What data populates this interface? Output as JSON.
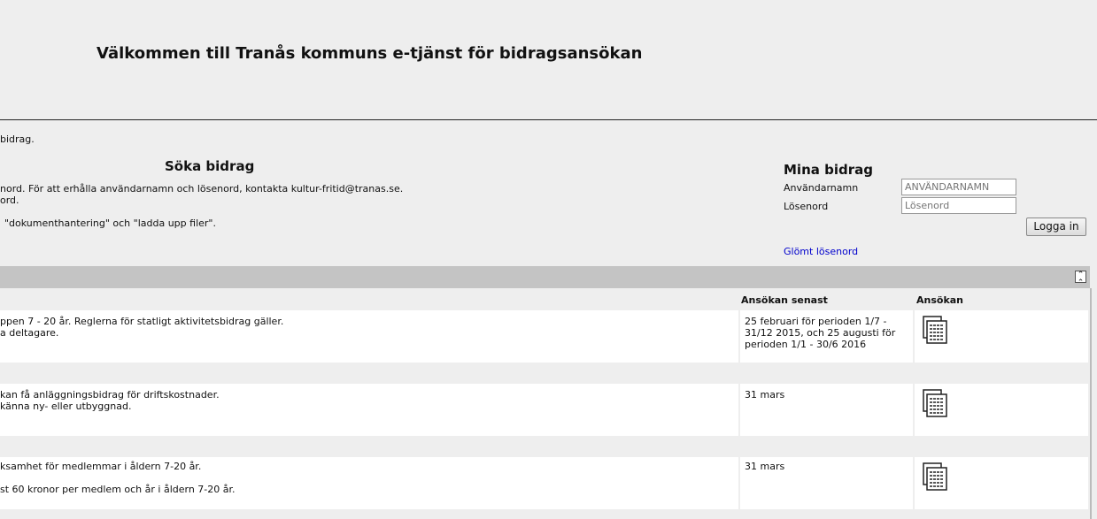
{
  "header": {
    "title": "Välkommen till Tranås kommuns e-tjänst för bidragsansökan"
  },
  "intro": {
    "line1": "bidrag."
  },
  "soka": {
    "heading": "Söka bidrag",
    "line1": "nord. För att erhålla användarnamn och lösenord, kontakta kultur-fritid@tranas.se.",
    "line2": "ord.",
    "line3": "\"dokumenthantering\" och \"ladda upp filer\"."
  },
  "login": {
    "heading": "Mina bidrag",
    "username_label": "Användarnamn",
    "username_placeholder": "ANVÄNDARNAMN",
    "password_label": "Lösenord",
    "password_placeholder": "Lösenord",
    "login_button": "Logga in",
    "forgot_link": "Glömt lösenord"
  },
  "table": {
    "col_deadline": "Ansökan senast",
    "col_apply": "Ansökan",
    "rows": [
      {
        "desc1": "ppen 7 - 20 år. Reglerna för statligt aktivitetsbidrag gäller.",
        "desc2": "a deltagare.",
        "deadline": "25 februari för perioden 1/7 - 31/12 2015, och 25 augusti för perioden 1/1 - 30/6 2016",
        "icon": "document-icon"
      },
      {
        "desc1": "kan få anläggningsbidrag för driftskostnader.",
        "desc2": "känna ny- eller utbyggnad.",
        "deadline": "31 mars",
        "icon": "document-icon"
      },
      {
        "desc1": "ksamhet för medlemmar i åldern 7-20 år.",
        "desc2": "st 60 kronor per medlem och år i åldern 7-20 år.",
        "deadline": "31 mars",
        "icon": "document-icon"
      }
    ]
  }
}
